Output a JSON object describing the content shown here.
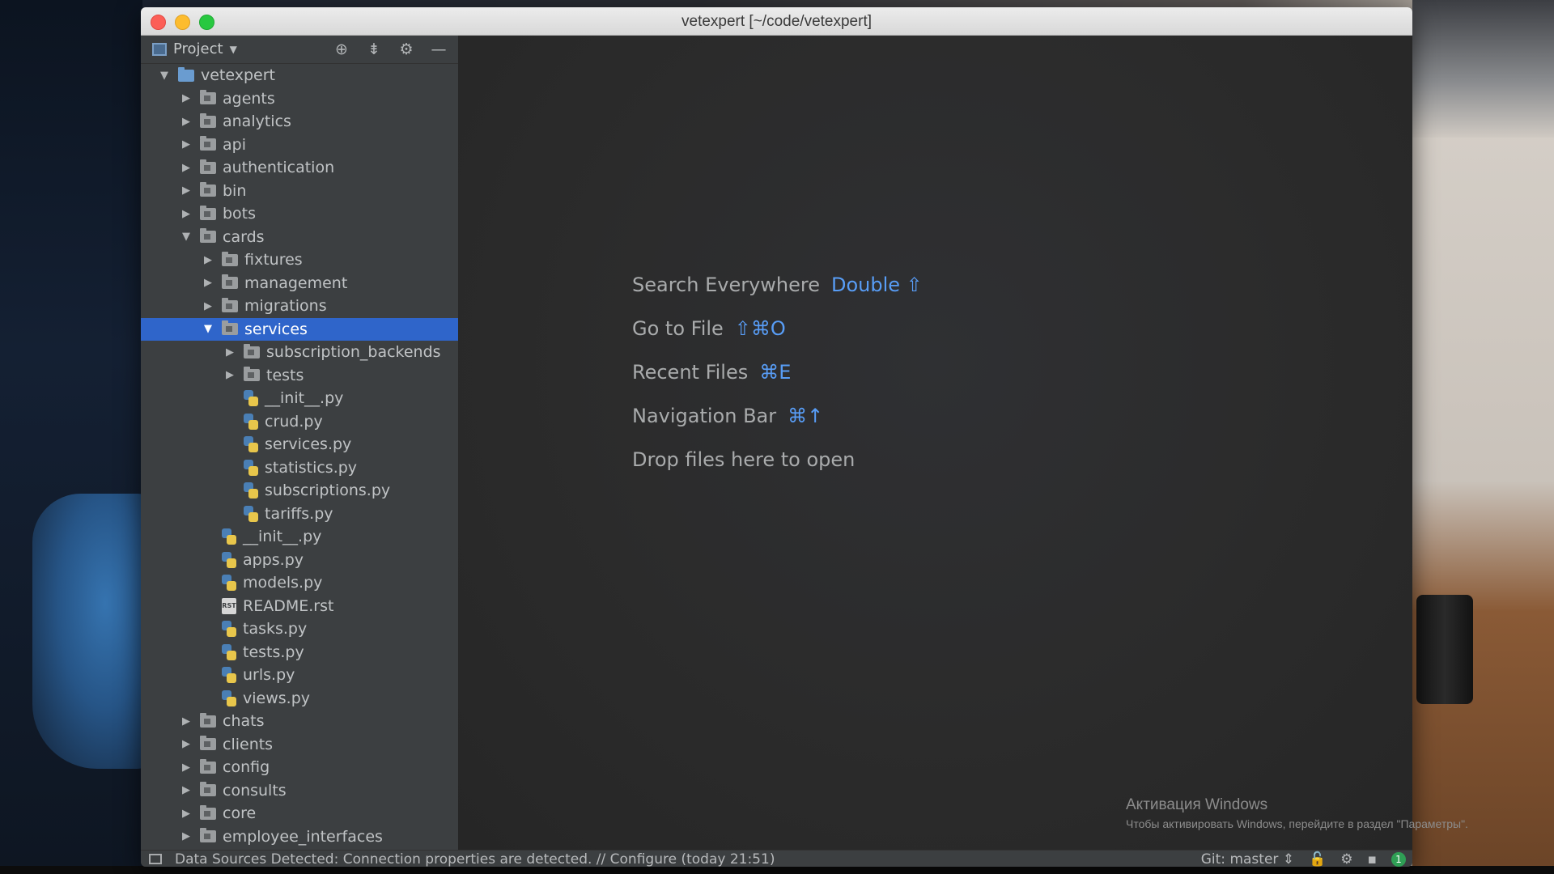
{
  "window": {
    "title": "vetexpert [~/code/vetexpert]"
  },
  "panel": {
    "title": "Project",
    "icons": [
      "crosshair-icon",
      "collapse-icon",
      "gear-icon",
      "minimize-icon"
    ]
  },
  "tree": [
    {
      "label": "vetexpert",
      "type": "root",
      "depth": 0,
      "state": "open"
    },
    {
      "label": "agents",
      "type": "folder",
      "depth": 1,
      "state": "closed"
    },
    {
      "label": "analytics",
      "type": "folder",
      "depth": 1,
      "state": "closed"
    },
    {
      "label": "api",
      "type": "folder",
      "depth": 1,
      "state": "closed"
    },
    {
      "label": "authentication",
      "type": "folder",
      "depth": 1,
      "state": "closed"
    },
    {
      "label": "bin",
      "type": "folder",
      "depth": 1,
      "state": "closed"
    },
    {
      "label": "bots",
      "type": "folder",
      "depth": 1,
      "state": "closed"
    },
    {
      "label": "cards",
      "type": "folder",
      "depth": 1,
      "state": "open"
    },
    {
      "label": "fixtures",
      "type": "folder",
      "depth": 2,
      "state": "closed"
    },
    {
      "label": "management",
      "type": "folder",
      "depth": 2,
      "state": "closed"
    },
    {
      "label": "migrations",
      "type": "folder",
      "depth": 2,
      "state": "closed"
    },
    {
      "label": "services",
      "type": "folder",
      "depth": 2,
      "state": "open",
      "selected": true
    },
    {
      "label": "subscription_backends",
      "type": "folder",
      "depth": 3,
      "state": "closed"
    },
    {
      "label": "tests",
      "type": "folder",
      "depth": 3,
      "state": "closed"
    },
    {
      "label": "__init__.py",
      "type": "py",
      "depth": 3
    },
    {
      "label": "crud.py",
      "type": "py",
      "depth": 3
    },
    {
      "label": "services.py",
      "type": "py",
      "depth": 3
    },
    {
      "label": "statistics.py",
      "type": "py",
      "depth": 3
    },
    {
      "label": "subscriptions.py",
      "type": "py",
      "depth": 3
    },
    {
      "label": "tariffs.py",
      "type": "py",
      "depth": 3
    },
    {
      "label": "__init__.py",
      "type": "py",
      "depth": 2
    },
    {
      "label": "apps.py",
      "type": "py",
      "depth": 2
    },
    {
      "label": "models.py",
      "type": "py",
      "depth": 2
    },
    {
      "label": "README.rst",
      "type": "rst",
      "depth": 2
    },
    {
      "label": "tasks.py",
      "type": "py",
      "depth": 2
    },
    {
      "label": "tests.py",
      "type": "py",
      "depth": 2
    },
    {
      "label": "urls.py",
      "type": "py",
      "depth": 2
    },
    {
      "label": "views.py",
      "type": "py",
      "depth": 2
    },
    {
      "label": "chats",
      "type": "folder",
      "depth": 1,
      "state": "closed"
    },
    {
      "label": "clients",
      "type": "folder",
      "depth": 1,
      "state": "closed"
    },
    {
      "label": "config",
      "type": "folder",
      "depth": 1,
      "state": "closed"
    },
    {
      "label": "consults",
      "type": "folder",
      "depth": 1,
      "state": "closed"
    },
    {
      "label": "core",
      "type": "folder",
      "depth": 1,
      "state": "closed"
    },
    {
      "label": "employee_interfaces",
      "type": "folder",
      "depth": 1,
      "state": "closed"
    }
  ],
  "editor": {
    "hints": [
      {
        "label": "Search Everywhere",
        "key": "Double ⇧"
      },
      {
        "label": "Go to File",
        "key": "⇧⌘O"
      },
      {
        "label": "Recent Files",
        "key": "⌘E"
      },
      {
        "label": "Navigation Bar",
        "key": "⌘↑"
      },
      {
        "label": "Drop files here to open",
        "key": ""
      }
    ]
  },
  "watermark": {
    "line1": "Активация Windows",
    "line2": "Чтобы активировать Windows, перейдите в раздел \"Параметры\"."
  },
  "statusbar": {
    "message": "Data Sources Detected: Connection properties are detected. // Configure (today 21:51)",
    "git": "Git: master ⇕",
    "notifications": "1"
  },
  "colors": {
    "accent": "#589df6",
    "selection": "#2f65ca",
    "panel": "#3c3f41",
    "editor": "#2b2b2b"
  }
}
